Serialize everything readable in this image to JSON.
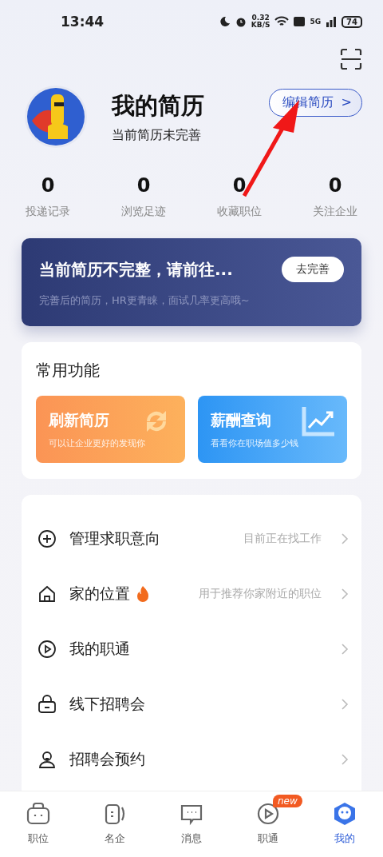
{
  "status_bar": {
    "time": "13:44",
    "speed": "0.32",
    "speed_unit": "KB/S",
    "network": "5G",
    "battery": "74"
  },
  "profile": {
    "title": "我的简历",
    "subtitle": "当前简历未完善",
    "edit_button": "编辑简历",
    "chevron": ">"
  },
  "stats": [
    {
      "value": "0",
      "label": "投递记录"
    },
    {
      "value": "0",
      "label": "浏览足迹"
    },
    {
      "value": "0",
      "label": "收藏职位"
    },
    {
      "value": "0",
      "label": "关注企业"
    }
  ],
  "banner": {
    "title": "当前简历不完整，请前往...",
    "subtitle": "完善后的简历，HR更青睐，面试几率更高哦~",
    "button": "去完善"
  },
  "features": {
    "title": "常用功能",
    "cards": [
      {
        "kind": "refresh",
        "title": "刷新简历",
        "subtitle": "可以让企业更好的发现你"
      },
      {
        "kind": "salary",
        "title": "薪酬查询",
        "subtitle": "看看你在职场值多少钱"
      }
    ]
  },
  "menu": [
    {
      "label": "管理求职意向",
      "hot": false,
      "hint": "目前正在找工作"
    },
    {
      "label": "家的位置",
      "hot": true,
      "hint": "用于推荐你家附近的职位"
    },
    {
      "label": "我的职通",
      "hot": false
    },
    {
      "label": "线下招聘会",
      "hot": false
    },
    {
      "label": "招聘会预约",
      "hot": false
    }
  ],
  "tab_bar": [
    {
      "label": "职位",
      "selected": false
    },
    {
      "label": "名企",
      "selected": false
    },
    {
      "label": "消息",
      "selected": false
    },
    {
      "label": "职通",
      "selected": false,
      "badge": "new"
    },
    {
      "label": "我的",
      "selected": true
    }
  ]
}
